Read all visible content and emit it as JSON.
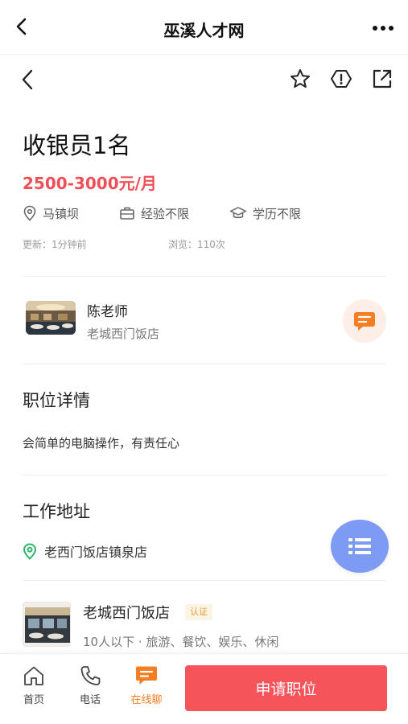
{
  "app": {
    "title": "巫溪人才网"
  },
  "job": {
    "title": "收银员1名",
    "salary": "2500-3000元/月",
    "tags": [
      {
        "icon": "location-pin-icon",
        "label": "马镇坝"
      },
      {
        "icon": "briefcase-icon",
        "label": "经验不限"
      },
      {
        "icon": "graduation-cap-icon",
        "label": "学历不限"
      }
    ],
    "updated": "更新：1分钟前",
    "views": "浏览：110次"
  },
  "recruiter": {
    "name": "陈老师",
    "company": "老城西门饭店"
  },
  "details": {
    "heading": "职位详情",
    "description": "会简单的电脑操作，有责任心"
  },
  "address": {
    "heading": "工作地址",
    "text": "老西门饭店镇泉店"
  },
  "company": {
    "name": "老城西门饭店",
    "badge": "认证",
    "info": "10人以下 · 旅游、餐饮、娱乐、休闲"
  },
  "bottom_nav": {
    "home": "首页",
    "phone": "电话",
    "chat": "在线聊",
    "apply": "申请职位"
  },
  "colors": {
    "salary": "#ef5058",
    "apply_button": "#f6545b",
    "chat_accent": "#f57e22",
    "float_button": "#7d9bf3",
    "address_pin": "#2fb36b"
  }
}
